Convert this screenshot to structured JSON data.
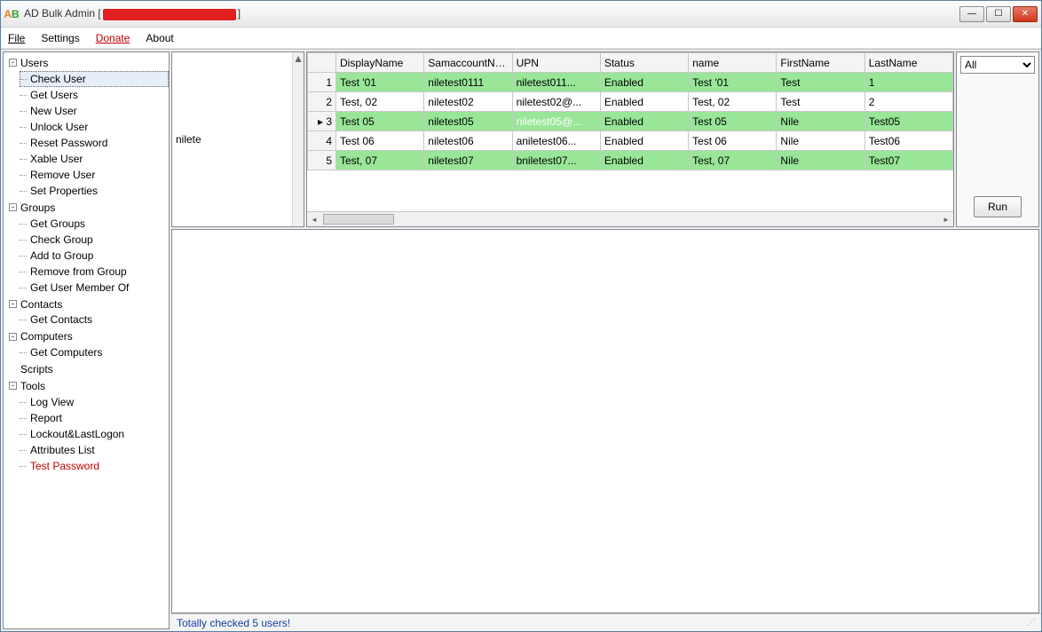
{
  "title_prefix": "AD Bulk Admin [",
  "title_suffix": "]",
  "menu": {
    "file": "File",
    "settings": "Settings",
    "donate": "Donate",
    "about": "About"
  },
  "tree": {
    "users": {
      "label": "Users",
      "items": [
        "Check User",
        "Get Users",
        "New User",
        "Unlock User",
        "Reset Password",
        "Xable User",
        "Remove User",
        "Set Properties"
      ]
    },
    "groups": {
      "label": "Groups",
      "items": [
        "Get Groups",
        "Check Group",
        "Add to Group",
        "Remove from Group",
        "Get User Member Of"
      ]
    },
    "contacts": {
      "label": "Contacts",
      "items": [
        "Get Contacts"
      ]
    },
    "computers": {
      "label": "Computers",
      "items": [
        "Get Computers"
      ]
    },
    "scripts": {
      "label": "Scripts"
    },
    "tools": {
      "label": "Tools",
      "items": [
        "Log View",
        "Report",
        "Lockout&LastLogon",
        "Attributes List",
        "Test Password"
      ]
    }
  },
  "search_value": "nilete",
  "grid": {
    "headers": [
      "DisplayName",
      "SamaccountName",
      "UPN",
      "Status",
      "name",
      "FirstName",
      "LastName"
    ],
    "rows": [
      {
        "n": "1",
        "green": true,
        "cells": [
          "Test '01",
          "niletest0111",
          "niletest011...",
          "Enabled",
          "Test '01",
          "Test",
          "1"
        ]
      },
      {
        "n": "2",
        "green": false,
        "cells": [
          "Test, 02",
          "niletest02",
          "niletest02@...",
          "Enabled",
          "Test, 02",
          "Test",
          "2"
        ]
      },
      {
        "n": "3",
        "green": true,
        "current": true,
        "selcol": 2,
        "cells": [
          "Test 05",
          "niletest05",
          "niletest05@...",
          "Enabled",
          "Test 05",
          "Nile",
          "Test05"
        ]
      },
      {
        "n": "4",
        "green": false,
        "cells": [
          "Test 06",
          "niletest06",
          "aniletest06...",
          "Enabled",
          "Test 06",
          "Nile",
          "Test06"
        ]
      },
      {
        "n": "5",
        "green": true,
        "cells": [
          "Test, 07",
          "niletest07",
          "bniletest07...",
          "Enabled",
          "Test, 07",
          "Nile",
          "Test07"
        ]
      }
    ]
  },
  "filter_options": [
    "All"
  ],
  "filter_selected": "All",
  "run_label": "Run",
  "status": "Totally checked 5 users!"
}
